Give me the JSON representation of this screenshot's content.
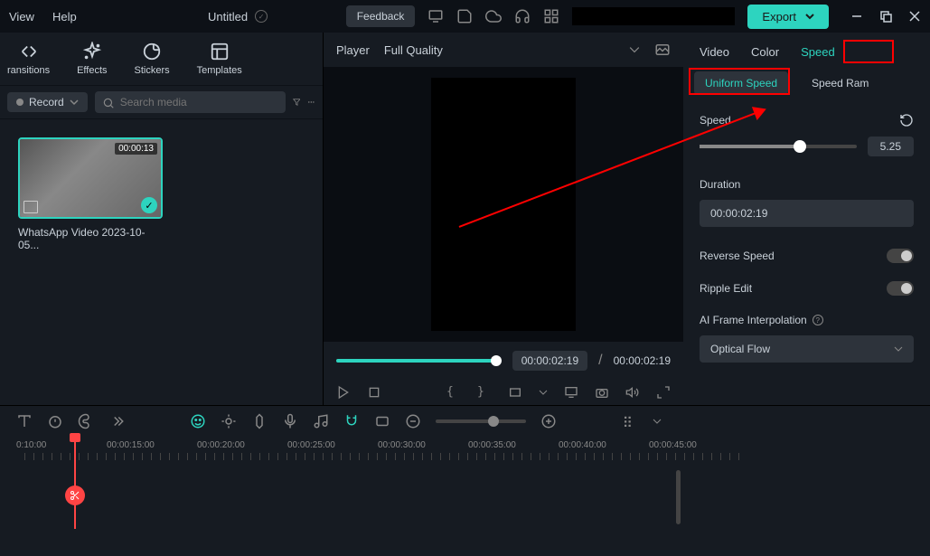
{
  "menu": {
    "view": "View",
    "help": "Help"
  },
  "title": "Untitled",
  "topbar": {
    "feedback": "Feedback",
    "export": "Export"
  },
  "tool_tabs": {
    "transitions": "ransitions",
    "effects": "Effects",
    "stickers": "Stickers",
    "templates": "Templates"
  },
  "record_btn": "Record",
  "search_placeholder": "Search media",
  "media": {
    "duration": "00:00:13",
    "name": "WhatsApp Video 2023-10-05..."
  },
  "player": {
    "label": "Player",
    "quality": "Full Quality",
    "current_time": "00:00:02:19",
    "total_time": "00:00:02:19"
  },
  "right_tabs": {
    "video": "Video",
    "color": "Color",
    "speed": "Speed"
  },
  "sub_tabs": {
    "uniform": "Uniform Speed",
    "ramp": "Speed Ram"
  },
  "speed_panel": {
    "speed_label": "Speed",
    "speed_value": "5.25",
    "duration_label": "Duration",
    "duration_value": "00:00:02:19",
    "reverse_label": "Reverse Speed",
    "ripple_label": "Ripple Edit",
    "ai_label": "AI Frame Interpolation",
    "interp_value": "Optical Flow"
  },
  "timeline": {
    "ticks": [
      "0:10:00",
      "00:00:15:00",
      "00:00:20:00",
      "00:00:25:00",
      "00:00:30:00",
      "00:00:35:00",
      "00:00:40:00",
      "00:00:45:00"
    ]
  }
}
